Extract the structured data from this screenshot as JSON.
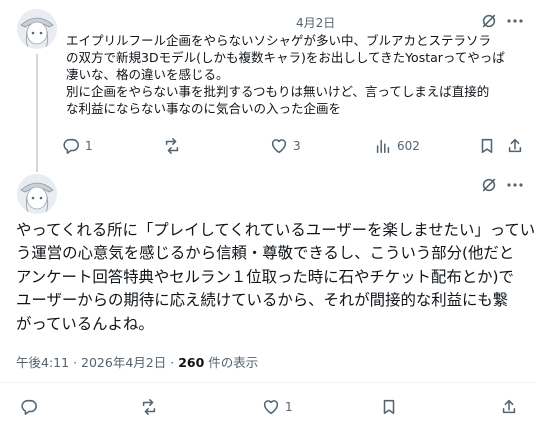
{
  "tweet1": {
    "date": "4月2日",
    "text_lines": [
      "エイプリルフール企画をやらないソシャゲが多い中、ブルアカとステラソラ",
      "の双方で新規3Dモデル(しかも複数キャラ)をお出ししてきたYostarってやっぱ",
      "凄いな、格の違いを感じる。",
      "別に企画をやらない事を批判するつもりは無いけど、言ってしまえば直接的",
      "な利益にならない事なのに気合いの入った企画を"
    ],
    "reply_count": "1",
    "like_count": "3",
    "view_count": "602"
  },
  "tweet2": {
    "text_lines": [
      "やってくれる所に「プレイしてくれているユーザーを楽しませたい」ってい",
      "う運営の心意気を感じるから信頼・尊敬できるし、こういう部分(他だと",
      "アンケート回答特典やセルラン１位取った時に石やチケット配布とか)で",
      "ユーザーからの期待に応え続けているから、それが間接的な利益にも繋",
      "がっているんよね。"
    ],
    "time": "午後4:11",
    "date": "2026年4月2日",
    "separator": "·",
    "views": "260",
    "views_suffix": "件の表示",
    "like_count": "1"
  },
  "icons": {
    "grok": "grok-icon",
    "more": "more-icon",
    "reply": "reply-icon",
    "retweet": "retweet-icon",
    "like": "heart-icon",
    "views": "views-icon",
    "bookmark": "bookmark-icon",
    "share": "share-icon"
  }
}
